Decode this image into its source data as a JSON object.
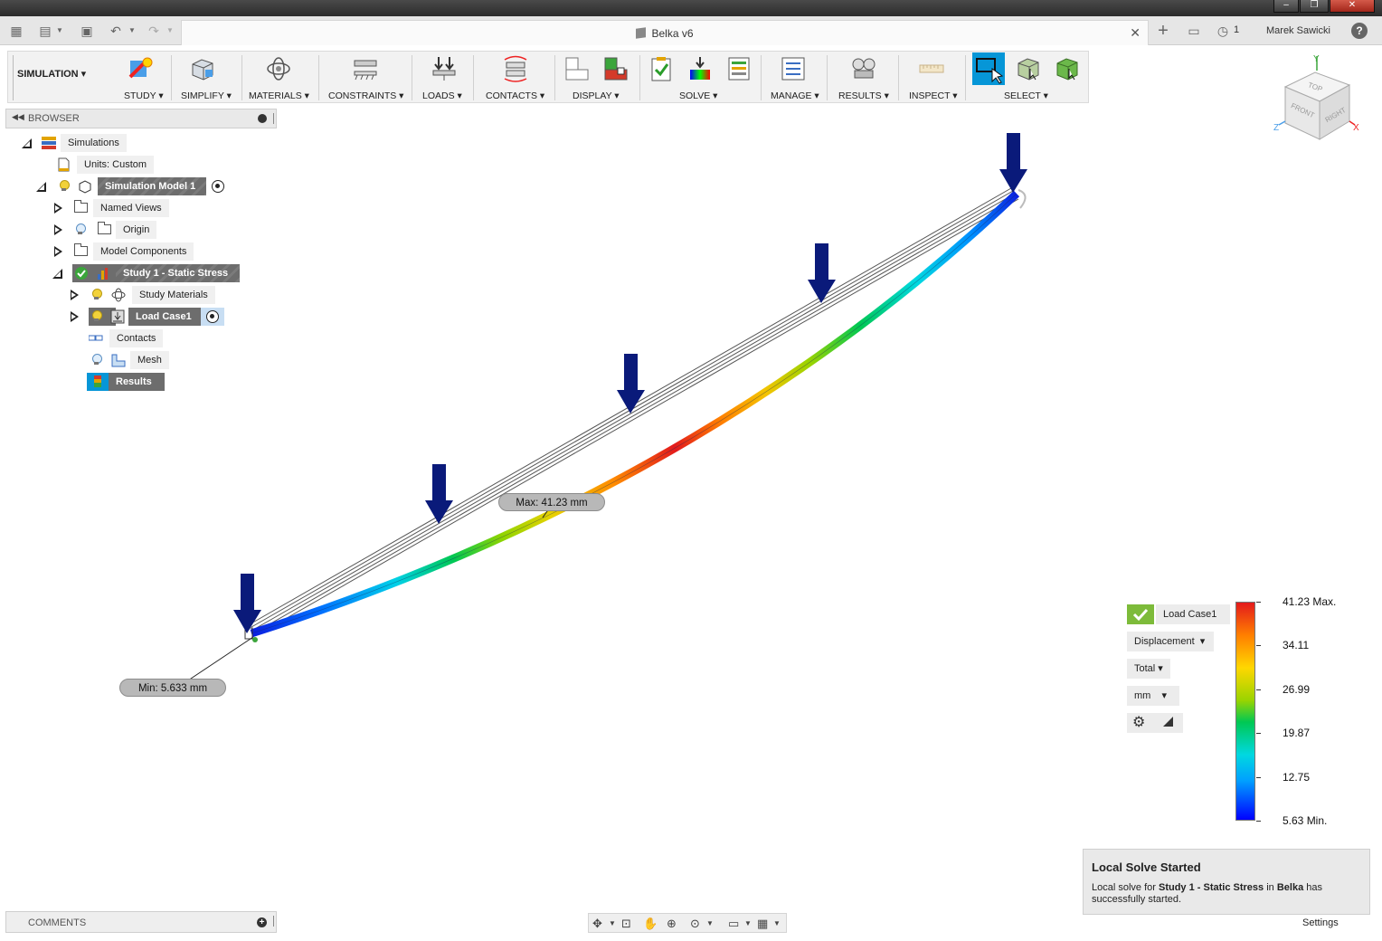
{
  "window": {
    "os_title": "",
    "doc_tab_title": "Belka v6",
    "job_count": "1",
    "user": "Marek Sawicki"
  },
  "ribbon": {
    "workspace": "SIMULATION",
    "groups": [
      {
        "label": "STUDY",
        "icon": "study-icon"
      },
      {
        "label": "SIMPLIFY",
        "icon": "simplify-icon"
      },
      {
        "label": "MATERIALS",
        "icon": "materials-icon"
      },
      {
        "label": "CONSTRAINTS",
        "icon": "constraints-icon"
      },
      {
        "label": "LOADS",
        "icon": "loads-icon"
      },
      {
        "label": "CONTACTS",
        "icon": "contacts-icon"
      },
      {
        "label": "DISPLAY",
        "icon": "display-icon"
      },
      {
        "label": "SOLVE",
        "icon": "solve-icon"
      },
      {
        "label": "MANAGE",
        "icon": "manage-icon"
      },
      {
        "label": "RESULTS",
        "icon": "results-icon"
      },
      {
        "label": "INSPECT",
        "icon": "inspect-icon"
      },
      {
        "label": "SELECT",
        "icon": "select-icon"
      }
    ]
  },
  "browser": {
    "title": "BROWSER",
    "nodes": {
      "simulations": "Simulations",
      "units": "Units: Custom",
      "sim_model": "Simulation Model 1",
      "named_views": "Named Views",
      "origin": "Origin",
      "model_components": "Model Components",
      "study": "Study 1 - Static Stress",
      "study_materials": "Study Materials",
      "load_case": "Load Case1",
      "contacts": "Contacts",
      "mesh": "Mesh",
      "results": "Results"
    }
  },
  "comments": {
    "title": "COMMENTS"
  },
  "viewport": {
    "max_label": "Max: 41.23 mm",
    "min_label": "Min: 5.633 mm"
  },
  "viewcube": {
    "top": "TOP",
    "front": "FRONT",
    "right": "RIGHT",
    "x": "X",
    "y": "Y",
    "z": "Z"
  },
  "legend": {
    "load_case": "Load Case1",
    "result_type": "Displacement",
    "component": "Total",
    "unit": "mm",
    "ticks": [
      "41.23 Max.",
      "34.11",
      "26.99",
      "19.87",
      "12.75",
      "5.63 Min."
    ],
    "max": 41.23,
    "min": 5.63
  },
  "toast": {
    "title": "Local Solve Started",
    "body_prefix": "Local solve for ",
    "study": "Study 1 - Static Stress",
    "in": " in ",
    "design": "Belka",
    "body_suffix": " has successfully started."
  },
  "settings": "Settings",
  "colors": {
    "load_arrow": "#0a1a7a",
    "accent": "#0696d7",
    "check": "#7dbb3a"
  }
}
